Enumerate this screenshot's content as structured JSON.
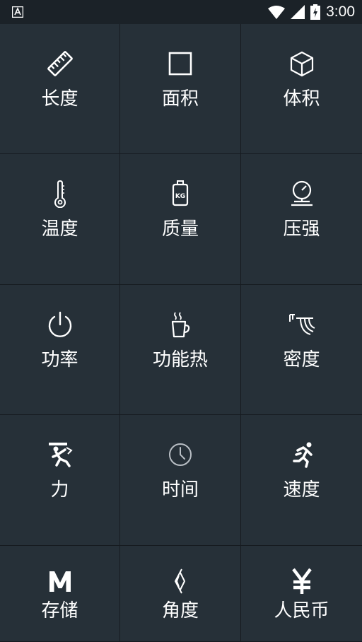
{
  "status_bar": {
    "time": "3:00"
  },
  "categories": [
    {
      "label": "长度",
      "icon": "ruler-icon"
    },
    {
      "label": "面积",
      "icon": "square-icon"
    },
    {
      "label": "体积",
      "icon": "cube-icon"
    },
    {
      "label": "温度",
      "icon": "thermometer-icon"
    },
    {
      "label": "质量",
      "icon": "weight-icon"
    },
    {
      "label": "压强",
      "icon": "pressure-gauge-icon"
    },
    {
      "label": "功率",
      "icon": "power-icon"
    },
    {
      "label": "功能热",
      "icon": "hot-cup-icon"
    },
    {
      "label": "密度",
      "icon": "density-icon"
    },
    {
      "label": "力",
      "icon": "force-icon"
    },
    {
      "label": "时间",
      "icon": "clock-icon"
    },
    {
      "label": "速度",
      "icon": "runner-icon"
    },
    {
      "label": "存储",
      "icon": "storage-m-icon"
    },
    {
      "label": "角度",
      "icon": "angle-icon"
    },
    {
      "label": "人民币",
      "icon": "yuan-icon"
    }
  ],
  "colors": {
    "background": "#263038",
    "status_bar": "#1b2228",
    "divider": "#161b20",
    "text": "#ffffff"
  }
}
